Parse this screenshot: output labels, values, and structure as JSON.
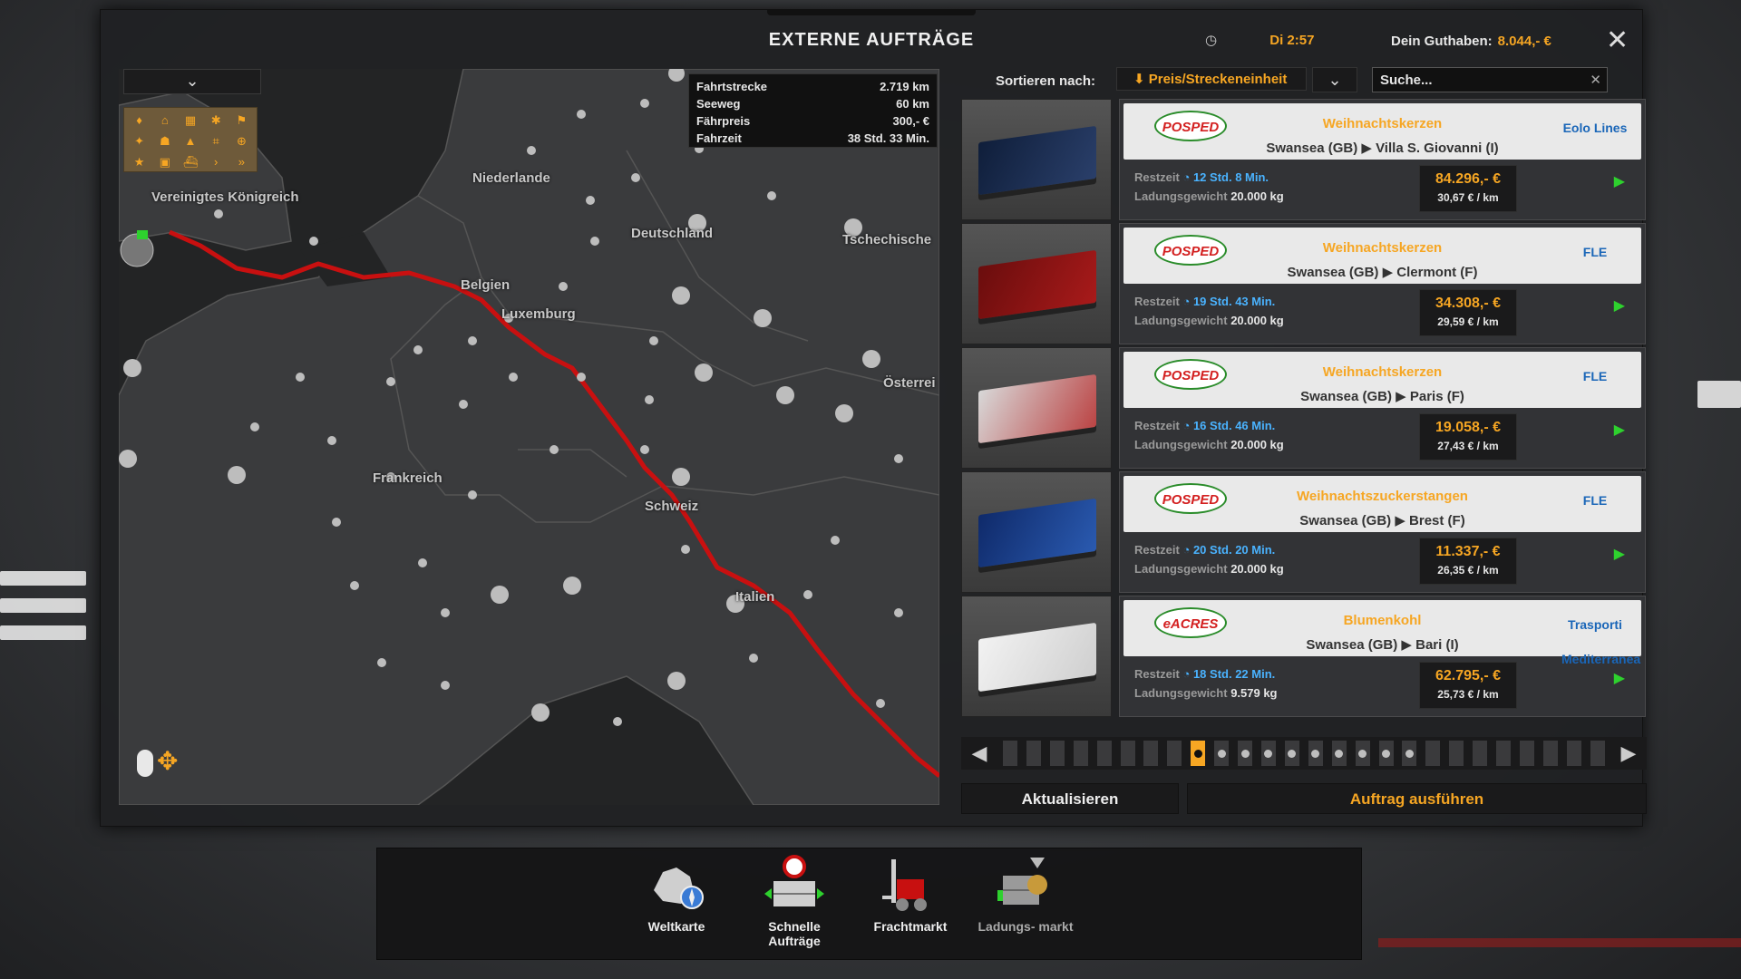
{
  "window": {
    "title": "EXTERNE AUFTRÄGE",
    "clock": "Di 2:57",
    "balance_label": "Dein Guthaben:",
    "balance_value": "8.044,- €"
  },
  "map": {
    "labels": [
      "Vereinigtes Königreich",
      "Niederlande",
      "Deutschland",
      "Tschechische",
      "Belgien",
      "Luxemburg",
      "Österrei",
      "Frankreich",
      "Schweiz",
      "Italien"
    ],
    "info": [
      {
        "key": "Fahrtstrecke",
        "value": "2.719 km"
      },
      {
        "key": "Seeweg",
        "value": "60 km"
      },
      {
        "key": "Fährpreis",
        "value": "300,- €"
      },
      {
        "key": "Fahrzeit",
        "value": "38 Std. 33 Min."
      }
    ]
  },
  "sort": {
    "label": "Sortieren nach:",
    "selected": "Preis/Streckeneinheit"
  },
  "search": {
    "placeholder": "Suche..."
  },
  "jobs": [
    {
      "company": "POSPED",
      "cargo": "Weihnachtskerzen",
      "origin": "Swansea (GB)",
      "destination": "Villa S. Giovanni (I)",
      "dest_company": "Eolo Lines",
      "remaining_label": "Restzeit",
      "remaining": "12 Std. 8 Min.",
      "weight_label": "Ladungsgewicht",
      "weight": "20.000 kg",
      "price": "84.296,- €",
      "per_km": "30,67 € / km"
    },
    {
      "company": "POSPED",
      "cargo": "Weihnachtskerzen",
      "origin": "Swansea (GB)",
      "destination": "Clermont (F)",
      "dest_company": "FLE",
      "remaining_label": "Restzeit",
      "remaining": "19 Std. 43 Min.",
      "weight_label": "Ladungsgewicht",
      "weight": "20.000 kg",
      "price": "34.308,- €",
      "per_km": "29,59 € / km"
    },
    {
      "company": "POSPED",
      "cargo": "Weihnachtskerzen",
      "origin": "Swansea (GB)",
      "destination": "Paris (F)",
      "dest_company": "FLE",
      "remaining_label": "Restzeit",
      "remaining": "16 Std. 46 Min.",
      "weight_label": "Ladungsgewicht",
      "weight": "20.000 kg",
      "price": "19.058,- €",
      "per_km": "27,43 € / km"
    },
    {
      "company": "POSPED",
      "cargo": "Weihnachtszuckerstangen",
      "origin": "Swansea (GB)",
      "destination": "Brest (F)",
      "dest_company": "FLE",
      "remaining_label": "Restzeit",
      "remaining": "20 Std. 20 Min.",
      "weight_label": "Ladungsgewicht",
      "weight": "20.000 kg",
      "price": "11.337,- €",
      "per_km": "26,35 € / km"
    },
    {
      "company": "eACRES",
      "cargo": "Blumenkohl",
      "origin": "Swansea (GB)",
      "destination": "Bari (I)",
      "dest_company": "Trasporti Mediterranea",
      "remaining_label": "Restzeit",
      "remaining": "18 Std. 22 Min.",
      "weight_label": "Ladungsgewicht",
      "weight": "9.579 kg",
      "price": "62.795,- €",
      "per_km": "25,73 € / km"
    }
  ],
  "pager": {
    "total_pages": 26,
    "active_page": 9
  },
  "buttons": {
    "refresh": "Aktualisieren",
    "execute": "Auftrag ausführen"
  },
  "dock": [
    {
      "label": "Weltkarte"
    },
    {
      "label": "Schnelle Aufträge"
    },
    {
      "label": "Frachtmarkt"
    },
    {
      "label": "Ladungs- markt"
    }
  ],
  "colors": {
    "accent": "#f6a623",
    "route": "#c81010",
    "time": "#4ab3ff",
    "go": "#2ed12e"
  }
}
